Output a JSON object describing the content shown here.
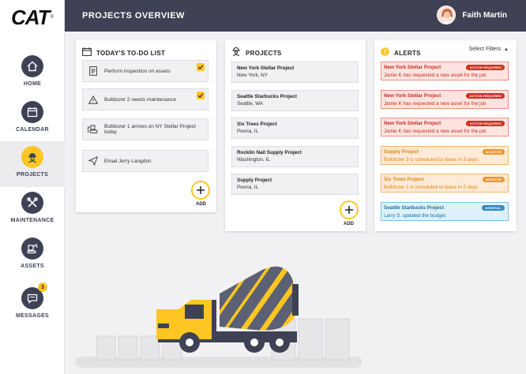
{
  "brand": {
    "logo": "CAT",
    "tm": "®"
  },
  "header": {
    "title": "PROJECTS OVERVIEW",
    "user_name": "Faith Martin"
  },
  "sidebar": {
    "items": [
      {
        "label": "HOME",
        "icon": "home-icon"
      },
      {
        "label": "CALENDAR",
        "icon": "calendar-icon"
      },
      {
        "label": "PROJECTS",
        "icon": "worker-icon",
        "active": true
      },
      {
        "label": "MAINTENANCE",
        "icon": "tools-icon"
      },
      {
        "label": "ASSETS",
        "icon": "excavator-icon"
      },
      {
        "label": "MESSAGES",
        "icon": "message-icon",
        "badge": "3"
      }
    ]
  },
  "todo": {
    "title": "TODAY'S TO-DO LIST",
    "items": [
      {
        "text": "Perform inspection on assets",
        "icon": "document-icon",
        "checked": true
      },
      {
        "text": "Bulldozer 2 needs maintenance",
        "icon": "warning-icon",
        "checked": true
      },
      {
        "text": "Bulldozer 1 arrives on NY Stellar Project today",
        "icon": "bulldozer-icon",
        "checked": false
      },
      {
        "text": "Email Jerry Langdon",
        "icon": "send-icon",
        "checked": false
      }
    ],
    "add_label": "ADD"
  },
  "projects": {
    "title": "PROJECTS",
    "items": [
      {
        "name": "New York Stellar Project",
        "location": "New York, NY"
      },
      {
        "name": "Seattle Starbucks Project",
        "location": "Seattle, WA"
      },
      {
        "name": "Six Trees Project",
        "location": "Peoria, IL"
      },
      {
        "name": "Rocklin Nail Supply Project",
        "location": "Washington, IL"
      },
      {
        "name": "Supply Project",
        "location": "Peoria, IL"
      }
    ],
    "add_label": "ADD"
  },
  "alerts": {
    "title": "ALERTS",
    "filter_label": "Select Filters",
    "items": [
      {
        "project": "New York Stellar Project",
        "tag": "ACTION REQUIRED",
        "message": "Jamie K has requested a new asset for the job",
        "level": "red"
      },
      {
        "project": "New York Stellar Project",
        "tag": "ACTION REQUIRED",
        "message": "Jamie K has requested a new asset for the job",
        "level": "red"
      },
      {
        "project": "New York Stellar Project",
        "tag": "ACTION REQUIRED",
        "message": "Jamie K has requested a new asset for the job",
        "level": "red"
      },
      {
        "project": "Supply Project",
        "tag": "MONITOR",
        "message": "Bulldozer 3 is scheduled to leave in 3 days",
        "level": "orange"
      },
      {
        "project": "Six Trees Project",
        "tag": "MONITOR",
        "message": "Bulldozer 1 is scheduled to leave in 5 days",
        "level": "orange"
      },
      {
        "project": "Seattle Starbucks Project",
        "tag": "GENERAL",
        "message": "Larry S. updated the budget",
        "level": "blue"
      }
    ]
  },
  "colors": {
    "accent": "#fdc623",
    "header": "#3e4254",
    "alert_red": "#c92a1c",
    "alert_orange": "#e08510",
    "alert_blue": "#1c6e98"
  }
}
